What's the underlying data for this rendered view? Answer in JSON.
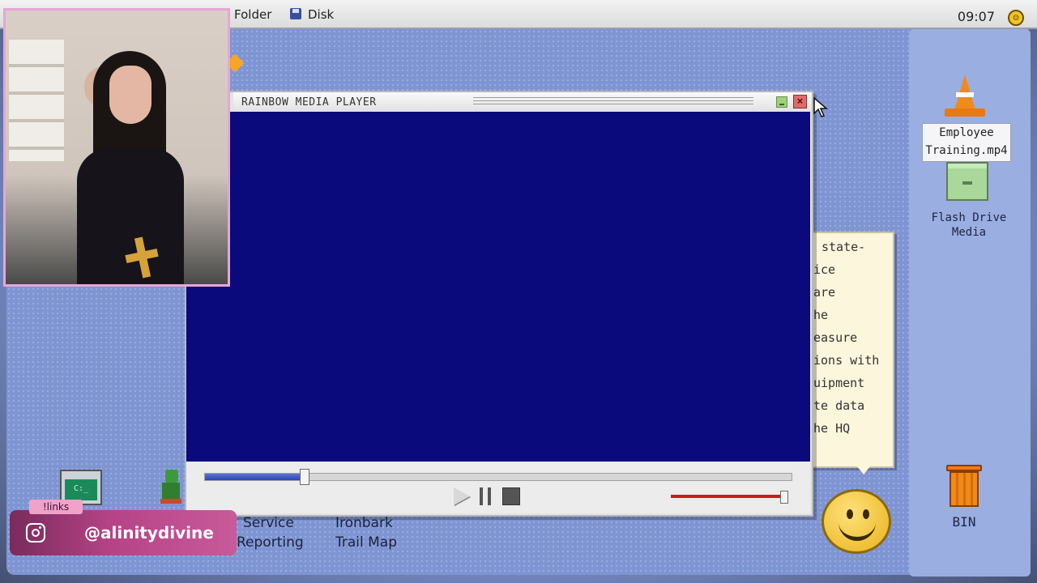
{
  "menubar": {
    "items": [
      "Folder",
      "Disk"
    ],
    "clock": "09:07"
  },
  "player": {
    "title": "RAINBOW MEDIA PLAYER",
    "close_symbol": "×",
    "seek_progress": 0.17,
    "volume_level": 1.0
  },
  "note": {
    "lines": [
      "state-",
      "ice",
      "are",
      "he",
      "easure",
      "ions with",
      "uipment",
      "te data",
      "he HQ"
    ]
  },
  "desktop": {
    "icons": [
      {
        "label_line1": "Employee",
        "label_line2": "Training.mp4",
        "icon": "traffic-cone-icon"
      },
      {
        "label_line1": "Flash Drive",
        "label_line2": "Media",
        "icon": "drawer-icon"
      },
      {
        "label": "BIN",
        "icon": "trash-bin-icon"
      }
    ],
    "bottom_items": [
      {
        "line1": "Service",
        "line2": "Reporting"
      },
      {
        "line1": "Ironbark",
        "line2": "Trail Map"
      }
    ],
    "terminal_glyph": "C:_"
  },
  "overlay": {
    "links_tag": "!links",
    "handle": "@alinitydivine"
  },
  "colors": {
    "desktop": "#7f95d3",
    "video": "#0a0a7c",
    "accent_pink": "#c85a9a",
    "volume": "#c81e1e"
  }
}
